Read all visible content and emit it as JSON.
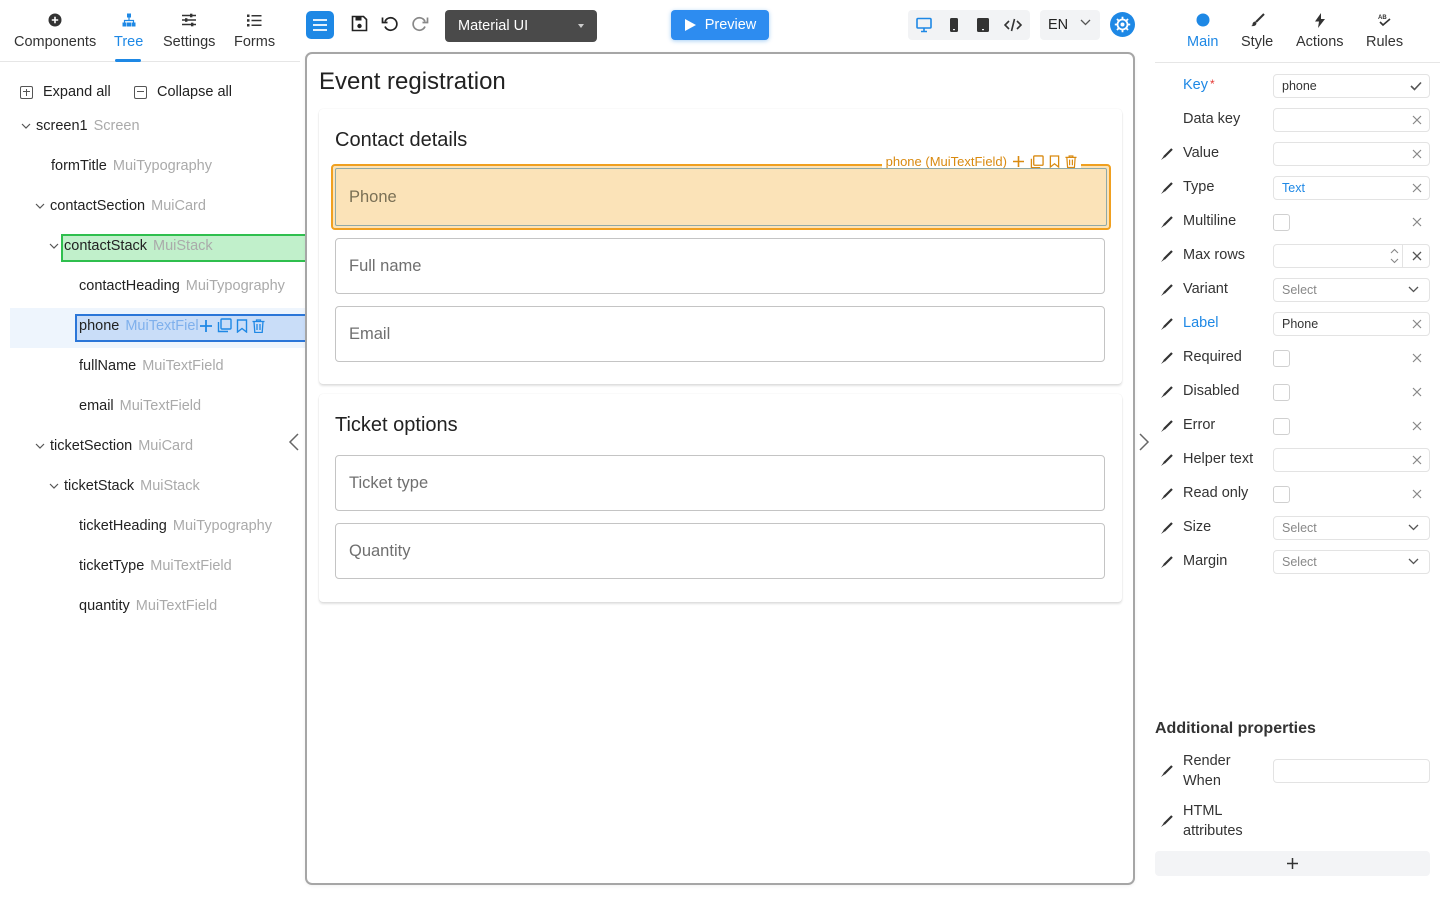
{
  "left_tabs": [
    {
      "label": "Components",
      "icon": "plus-circle-icon"
    },
    {
      "label": "Tree",
      "icon": "tree-icon",
      "active": true
    },
    {
      "label": "Settings",
      "icon": "sliders-icon"
    },
    {
      "label": "Forms",
      "icon": "list-icon"
    }
  ],
  "tree_actions": {
    "expand_all": "Expand all",
    "collapse_all": "Collapse all"
  },
  "tree": [
    {
      "name": "screen1",
      "type": "Screen"
    },
    {
      "name": "formTitle",
      "type": "MuiTypography"
    },
    {
      "name": "contactSection",
      "type": "MuiCard"
    },
    {
      "name": "contactStack",
      "type": "MuiStack"
    },
    {
      "name": "contactHeading",
      "type": "MuiTypography"
    },
    {
      "name": "phone",
      "type": "MuiTextFiel"
    },
    {
      "name": "fullName",
      "type": "MuiTextField"
    },
    {
      "name": "email",
      "type": "MuiTextField"
    },
    {
      "name": "ticketSection",
      "type": "MuiCard"
    },
    {
      "name": "ticketStack",
      "type": "MuiStack"
    },
    {
      "name": "ticketHeading",
      "type": "MuiTypography"
    },
    {
      "name": "ticketType",
      "type": "MuiTextField"
    },
    {
      "name": "quantity",
      "type": "MuiTextField"
    }
  ],
  "toolbar": {
    "library": "Material UI",
    "preview_label": "Preview",
    "language": "EN"
  },
  "canvas": {
    "form_title": "Event registration",
    "contact_heading": "Contact details",
    "selection_label": "phone (MuiTextField)",
    "fields_contact": [
      "Phone",
      "Full name",
      "Email"
    ],
    "ticket_heading": "Ticket options",
    "fields_ticket": [
      "Ticket type",
      "Quantity"
    ]
  },
  "right_tabs": [
    {
      "label": "Main",
      "icon": "dot-icon",
      "active": true
    },
    {
      "label": "Style",
      "icon": "brush-icon"
    },
    {
      "label": "Actions",
      "icon": "bolt-icon"
    },
    {
      "label": "Rules",
      "icon": "rules-icon"
    }
  ],
  "props": {
    "key": {
      "label": "Key",
      "required_mark": "*",
      "value": "phone"
    },
    "data_key": {
      "label": "Data key",
      "value": ""
    },
    "value": {
      "label": "Value",
      "value": ""
    },
    "type": {
      "label": "Type",
      "value": "Text"
    },
    "multiline": {
      "label": "Multiline"
    },
    "max_rows": {
      "label": "Max rows",
      "value": ""
    },
    "variant": {
      "label": "Variant",
      "placeholder": "Select"
    },
    "label": {
      "label": "Label",
      "value": "Phone"
    },
    "required": {
      "label": "Required"
    },
    "disabled": {
      "label": "Disabled"
    },
    "error": {
      "label": "Error"
    },
    "helper_text": {
      "label": "Helper text",
      "value": ""
    },
    "read_only": {
      "label": "Read only"
    },
    "size": {
      "label": "Size",
      "placeholder": "Select"
    },
    "margin": {
      "label": "Margin",
      "placeholder": "Select"
    }
  },
  "additional": {
    "title": "Additional properties",
    "render_when": "Render When",
    "html_attributes": "HTML attributes",
    "add_symbol": "+"
  },
  "colors": {
    "accent": "#1e88e5",
    "selection": "#f0a020",
    "tree_green": "#2fbf4e",
    "tree_blue": "#2b76d8"
  }
}
